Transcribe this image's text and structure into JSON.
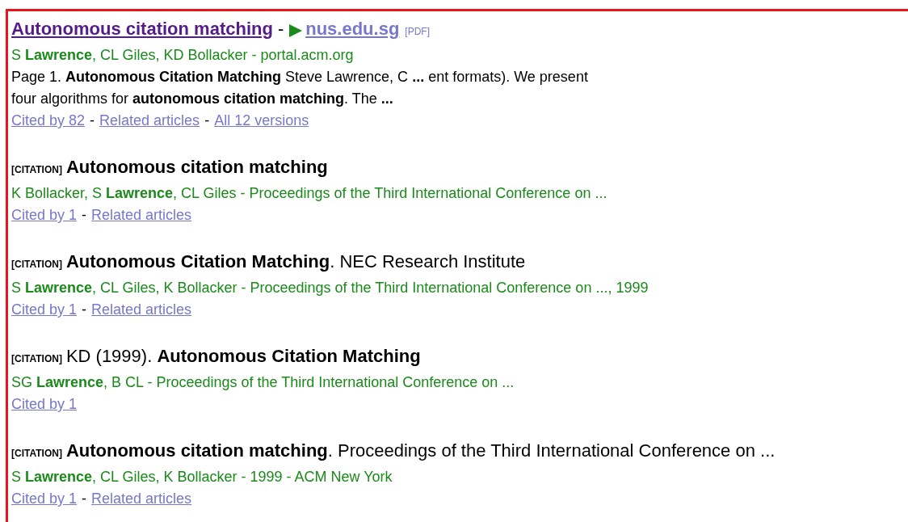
{
  "results": [
    {
      "kind": "pdf",
      "title": "Autonomous citation matching",
      "separator": "-",
      "source": "nus.edu.sg",
      "format": "[PDF]",
      "authors": "S **Lawrence**, CL Giles, KD Bollacker - portal.acm.org",
      "snippet": [
        "Page 1. **Autonomous Citation Matching** Steve Lawrence, C **...** ent formats). We present",
        "four algorithms for **autonomous citation matching**. The **...**"
      ],
      "links": [
        {
          "text": "Cited by 82"
        },
        {
          "separator": "-",
          "text": "Related articles"
        },
        {
          "separator": "-",
          "text": "All 12 versions"
        }
      ]
    },
    {
      "kind": "citation",
      "tag": "[CITATION]",
      "title": "**Autonomous citation matching**",
      "authors": "K Bollacker, S **Lawrence**, CL Giles - Proceedings of the Third International Conference on ...",
      "links": [
        {
          "text": "Cited by 1"
        },
        {
          "separator": "-",
          "text": "Related articles"
        }
      ]
    },
    {
      "kind": "citation",
      "tag": "[CITATION]",
      "title": "**Autonomous Citation Matching**. NEC Research Institute",
      "authors": "S **Lawrence**, CL Giles, K Bollacker - Proceedings of the Third International Conference on ..., 1999",
      "links": [
        {
          "text": "Cited by 1"
        },
        {
          "separator": "-",
          "text": "Related articles"
        }
      ]
    },
    {
      "kind": "citation",
      "tag": "[CITATION]",
      "title": "KD (1999). **Autonomous Citation Matching**",
      "authors": "SG **Lawrence**, B CL - Proceedings of the Third International Conference on ...",
      "links": [
        {
          "text": "Cited by 1"
        }
      ]
    },
    {
      "kind": "citation",
      "tag": "[CITATION]",
      "title": "**Autonomous citation matching**. Proceedings of the Third International Conference on ...",
      "authors": "S **Lawrence**, CL Giles, K Bollacker - 1999 - ACM New York",
      "links": [
        {
          "text": "Cited by 1"
        },
        {
          "separator": "-",
          "text": "Related articles"
        }
      ]
    }
  ]
}
